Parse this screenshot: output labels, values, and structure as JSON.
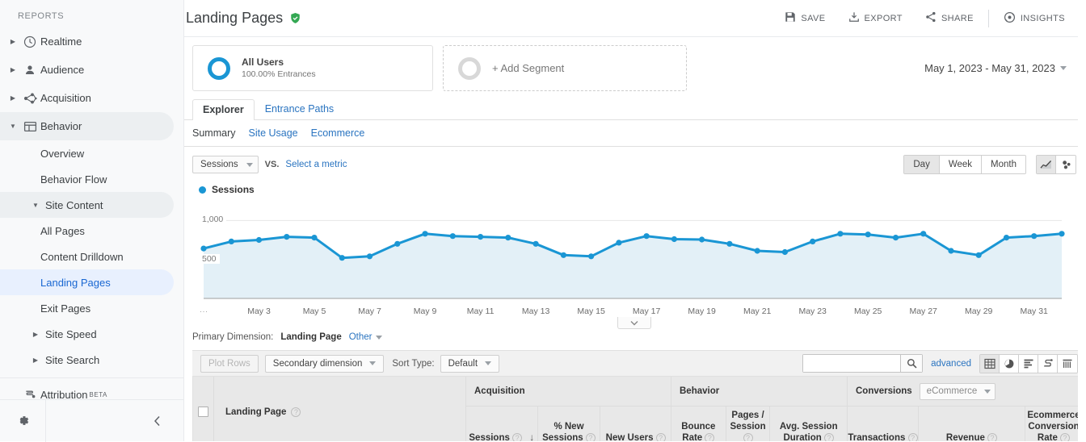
{
  "sidebar": {
    "section_label": "REPORTS",
    "items": [
      {
        "label": "Realtime",
        "icon": "clock-icon"
      },
      {
        "label": "Audience",
        "icon": "person-icon"
      },
      {
        "label": "Acquisition",
        "icon": "acquisition-icon"
      },
      {
        "label": "Behavior",
        "icon": "behavior-icon"
      }
    ],
    "behavior_children": [
      {
        "label": "Overview"
      },
      {
        "label": "Behavior Flow"
      },
      {
        "label": "Site Content"
      },
      {
        "label": "All Pages"
      },
      {
        "label": "Content Drilldown"
      },
      {
        "label": "Landing Pages"
      },
      {
        "label": "Exit Pages"
      },
      {
        "label": "Site Speed"
      },
      {
        "label": "Site Search"
      }
    ],
    "attribution": {
      "label": "Attribution",
      "badge": "BETA"
    }
  },
  "header": {
    "title": "Landing Pages",
    "actions": [
      {
        "label": "SAVE",
        "icon": "save-icon"
      },
      {
        "label": "EXPORT",
        "icon": "export-icon"
      },
      {
        "label": "SHARE",
        "icon": "share-icon"
      },
      {
        "label": "INSIGHTS",
        "icon": "insights-icon"
      }
    ]
  },
  "segments": {
    "all_users": {
      "name": "All Users",
      "sub": "100.00% Entrances"
    },
    "add_segment": "+ Add Segment",
    "date_range": "May 1, 2023 - May 31, 2023"
  },
  "tabs": [
    {
      "label": "Explorer",
      "active": true
    },
    {
      "label": "Entrance Paths",
      "active": false
    }
  ],
  "subtabs": [
    {
      "label": "Summary",
      "active": true
    },
    {
      "label": "Site Usage",
      "active": false
    },
    {
      "label": "Ecommerce",
      "active": false
    }
  ],
  "chart_controls": {
    "metric": "Sessions",
    "vs_label": "VS.",
    "select_metric": "Select a metric",
    "granularity": [
      {
        "label": "Day",
        "active": true
      },
      {
        "label": "Week",
        "active": false
      },
      {
        "label": "Month",
        "active": false
      }
    ],
    "chart_icons": [
      {
        "name": "line-chart-icon",
        "active": true
      },
      {
        "name": "motion-chart-icon",
        "active": false
      }
    ]
  },
  "chart_data": {
    "type": "line",
    "title": "Sessions",
    "series": [
      {
        "name": "Sessions",
        "color": "#1a96d4",
        "values": [
          640,
          730,
          750,
          790,
          780,
          520,
          540,
          700,
          830,
          800,
          790,
          780,
          700,
          555,
          540,
          715,
          800,
          760,
          755,
          700,
          610,
          595,
          730,
          830,
          820,
          780,
          830,
          610,
          555,
          780,
          800,
          830
        ]
      }
    ],
    "x": [
      "May 1",
      "May 2",
      "May 3",
      "May 4",
      "May 5",
      "May 6",
      "May 7",
      "May 8",
      "May 9",
      "May 10",
      "May 11",
      "May 12",
      "May 13",
      "May 14",
      "May 15",
      "May 16",
      "May 17",
      "May 18",
      "May 19",
      "May 20",
      "May 21",
      "May 22",
      "May 23",
      "May 24",
      "May 25",
      "May 26",
      "May 27",
      "May 28",
      "May 29",
      "May 30",
      "May 31"
    ],
    "xticks": [
      "May 3",
      "May 5",
      "May 7",
      "May 9",
      "May 11",
      "May 13",
      "May 15",
      "May 17",
      "May 19",
      "May 21",
      "May 23",
      "May 25",
      "May 27",
      "May 29",
      "May 31"
    ],
    "yticks": [
      "1,000",
      "500"
    ],
    "ylim": [
      0,
      1200
    ],
    "grid": true,
    "legend": "Sessions",
    "legend_position": "top-left",
    "xlabel": "",
    "ylabel": ""
  },
  "primary_dimension": {
    "label": "Primary Dimension:",
    "value": "Landing Page",
    "other": "Other"
  },
  "table_toolbar": {
    "plot_rows": "Plot Rows",
    "secondary_dimension": "Secondary dimension",
    "sort_type_label": "Sort Type:",
    "sort_type_value": "Default",
    "search_placeholder": "",
    "search_value": "",
    "advanced": "advanced",
    "view_icons": [
      {
        "name": "table-view-icon",
        "active": true
      },
      {
        "name": "pie-view-icon",
        "active": false
      },
      {
        "name": "performance-view-icon",
        "active": false
      },
      {
        "name": "comparison-view-icon",
        "active": false
      },
      {
        "name": "pivot-view-icon",
        "active": false
      }
    ]
  },
  "table": {
    "dimension_header": "Landing Page",
    "groups": [
      {
        "label": "Acquisition",
        "columns": [
          "Sessions",
          "% New Sessions",
          "New Users"
        ]
      },
      {
        "label": "Behavior",
        "columns": [
          "Bounce Rate",
          "Pages / Session",
          "Avg. Session Duration"
        ]
      },
      {
        "label": "Conversions",
        "dropdown": "eCommerce",
        "columns": [
          "Transactions",
          "Revenue",
          "Ecommerce Conversion Rate"
        ]
      }
    ],
    "sorted_column": "Sessions"
  },
  "colors": {
    "accent": "#1a96d4",
    "link": "#2a74c0",
    "selected_nav_bg": "#e8f0fe",
    "selected_nav_text": "#1967d2",
    "verified_green": "#34a853",
    "chart_fill": "#e3f0f7"
  }
}
